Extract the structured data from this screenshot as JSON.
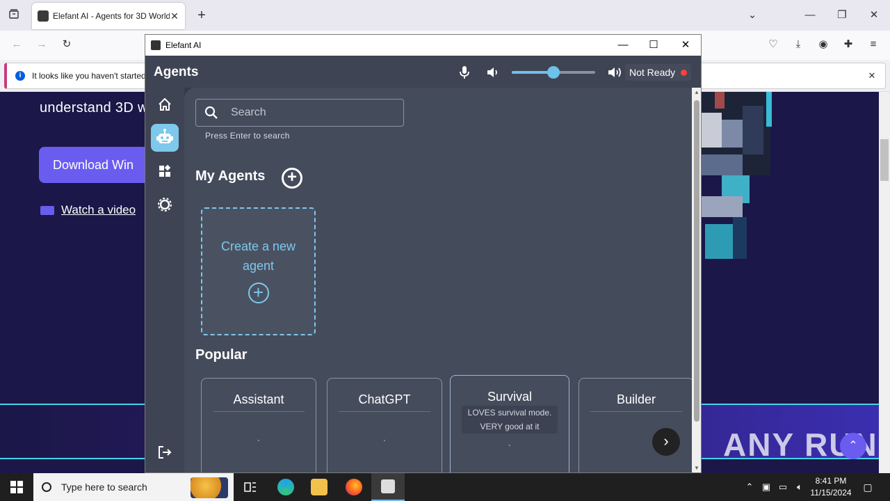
{
  "browser": {
    "tab_title": "Elefant AI - Agents for 3D World",
    "new_tab": "+",
    "infobar_text": "It looks like you haven't started"
  },
  "page": {
    "hero_text": "understand 3D w",
    "download_label": "Download Win",
    "watch_label": "Watch a video",
    "watermark": "ANY RUN"
  },
  "window": {
    "title": "Elefant AI"
  },
  "app": {
    "header": "Agents",
    "volume_level": 0.5,
    "status_text": "Not Ready",
    "status_color": "#ff4040",
    "accent": "#7ec8ec",
    "search_placeholder": "Search",
    "search_helper": "Press Enter to search",
    "my_agents_title": "My Agents",
    "create_label": "Create a new agent",
    "popular_title": "Popular",
    "popular": [
      {
        "name": "Assistant",
        "desc": ""
      },
      {
        "name": "ChatGPT",
        "desc": ""
      },
      {
        "name": "Survival",
        "desc": "LOVES survival mode. VERY good at it"
      },
      {
        "name": "Builder",
        "desc": ""
      }
    ]
  },
  "taskbar": {
    "search_placeholder": "Type here to search",
    "time": "8:41 PM",
    "date": "11/15/2024"
  }
}
